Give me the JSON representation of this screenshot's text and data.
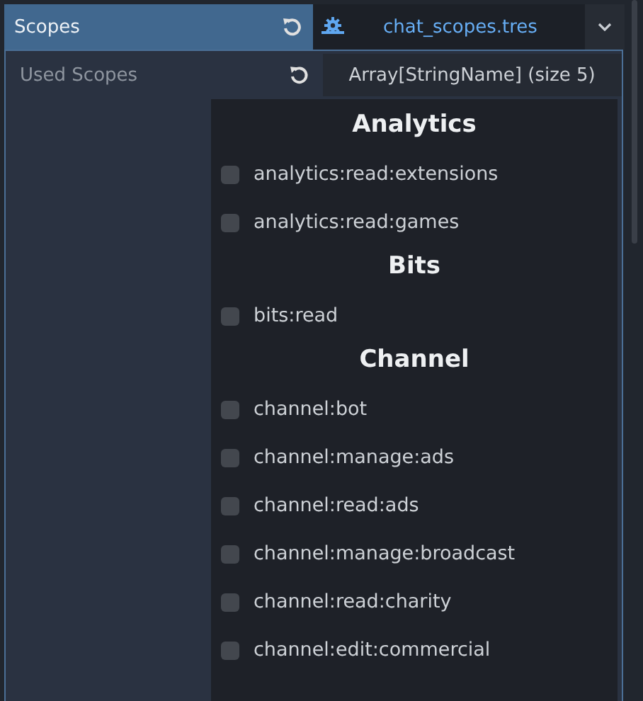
{
  "section": {
    "title": "Scopes"
  },
  "resource": {
    "name": "chat_scopes.tres"
  },
  "property": {
    "label": "Used Scopes",
    "value": "Array[StringName] (size 5)"
  },
  "popup": {
    "groups": [
      {
        "title": "Analytics",
        "items": [
          {
            "label": "analytics:read:extensions",
            "checked": false
          },
          {
            "label": "analytics:read:games",
            "checked": false
          }
        ]
      },
      {
        "title": "Bits",
        "items": [
          {
            "label": "bits:read",
            "checked": false
          }
        ]
      },
      {
        "title": "Channel",
        "items": [
          {
            "label": "channel:bot",
            "checked": false
          },
          {
            "label": "channel:manage:ads",
            "checked": false
          },
          {
            "label": "channel:read:ads",
            "checked": false
          },
          {
            "label": "channel:manage:broadcast",
            "checked": false
          },
          {
            "label": "channel:read:charity",
            "checked": false
          },
          {
            "label": "channel:edit:commercial",
            "checked": false
          }
        ]
      }
    ]
  }
}
